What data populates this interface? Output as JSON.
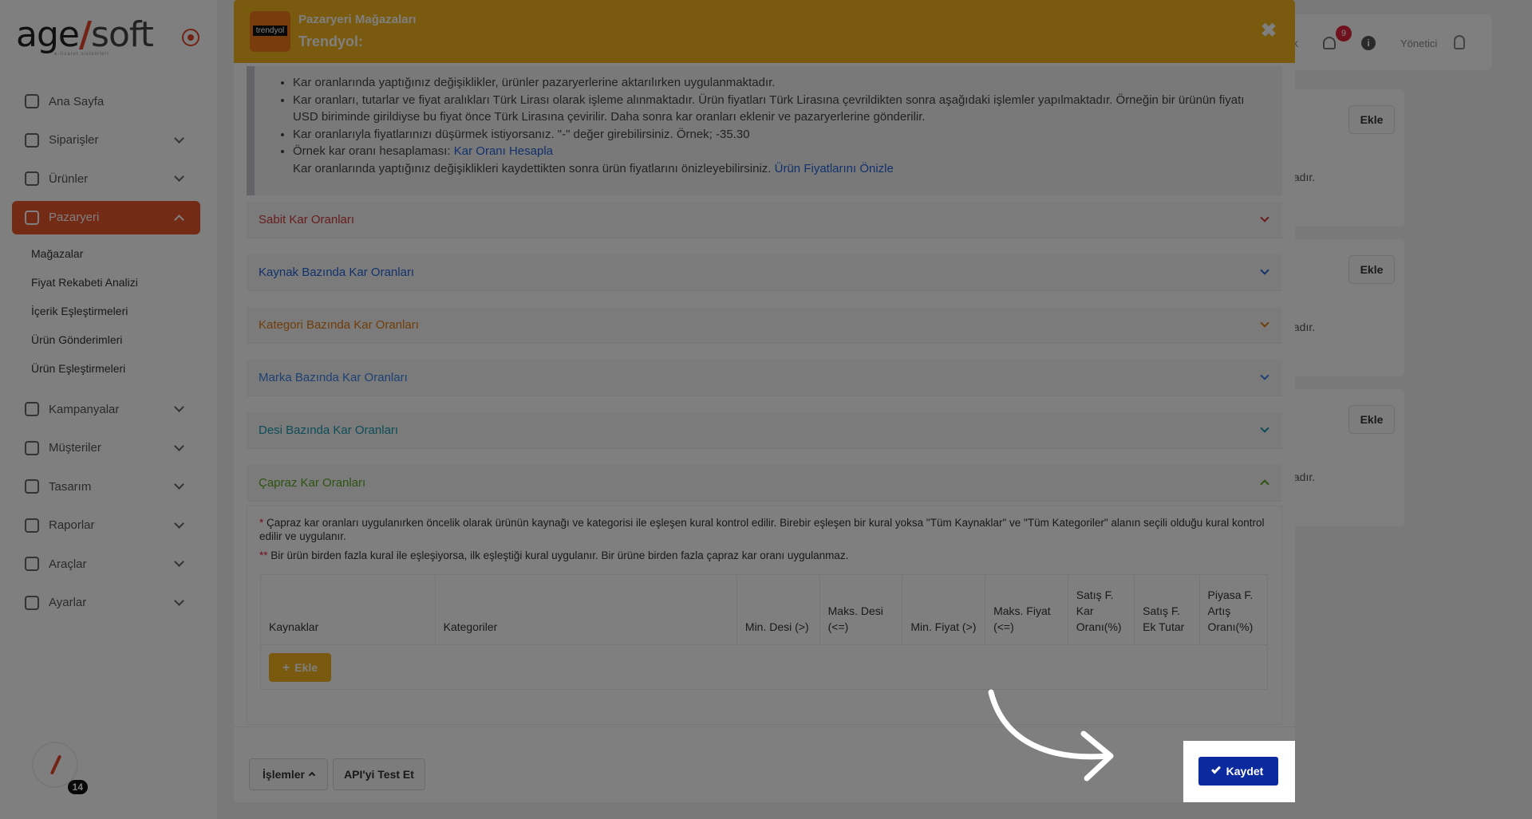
{
  "sidebar": {
    "logo_main": "age",
    "logo_slash": "/",
    "logo_soft": "soft",
    "logo_sub": "e-ticaret sistemleri",
    "items": [
      {
        "label": "Ana Sayfa",
        "icon": "home-icon"
      },
      {
        "label": "Siparişler",
        "icon": "cart-icon"
      },
      {
        "label": "Ürünler",
        "icon": "book-icon"
      },
      {
        "label": "Pazaryeri",
        "icon": "box-icon"
      },
      {
        "label": "Kampanyalar",
        "icon": "basket-icon"
      },
      {
        "label": "Müşteriler",
        "icon": "user-icon"
      },
      {
        "label": "Tasarım",
        "icon": "edit-icon"
      },
      {
        "label": "Raporlar",
        "icon": "chart-icon"
      },
      {
        "label": "Araçlar",
        "icon": "clipboard-icon"
      },
      {
        "label": "Ayarlar",
        "icon": "gear-icon"
      }
    ],
    "sub_items": [
      "Mağazalar",
      "Fiyat Rekabeti Analizi",
      "İçerik Eşleştirmeleri",
      "Ürün Gönderimleri",
      "Ürün Eşleştirmeleri"
    ],
    "badge_count": "14"
  },
  "topbar": {
    "partial_text": "k",
    "notification_count": "9",
    "info_glyph": "i",
    "user_name": "Yönetici"
  },
  "background_cards": [
    {
      "button": "Ekle",
      "tail": "ktadır."
    },
    {
      "button": "Ekle",
      "tail": "ktadır."
    },
    {
      "button": "Ekle",
      "tail": "ktadır."
    }
  ],
  "modal": {
    "brand_logo_text": "trendyol",
    "subtitle": "Pazaryeri Mağazaları",
    "title": "Trendyol:",
    "close_glyph": "✖",
    "info": {
      "line1": "Kar oranlarında yaptığınız değişiklikler, ürünler pazaryerlerine aktarılırken uygulanmaktadır.",
      "line2": "Kar oranları, tutarlar ve fiyat aralıkları Türk Lirası olarak işleme alınmaktadır. Ürün fiyatları Türk Lirasına çevrildikten sonra aşağıdaki işlemler yapılmaktadır. Örneğin bir ürünün fiyatı USD biriminde girildiyse bu fiyat önce Türk Lirasına çevirilir. Daha sonra kar oranları eklenir ve pazaryerlerine gönderilir.",
      "line3": "Kar oranlarıyla fiyatlarınızı düşürmek istiyorsanız. \"-\" değer girebilirsiniz. Örnek; -35.30",
      "line4_prefix": "Örnek kar oranı hesaplaması: ",
      "line4_link": "Kar Oranı Hesapla",
      "line5_prefix": "Kar oranlarında yaptığınız değişiklikleri kaydettikten sonra ürün fiyatlarını önizleyebilirsiniz. ",
      "line5_link": "Ürün Fiyatlarını Önizle"
    },
    "sections": [
      {
        "label": "Sabit Kar Oranları",
        "color": "#d23a3a"
      },
      {
        "label": "Kaynak Bazında Kar Oranları",
        "color": "#2563d6"
      },
      {
        "label": "Kategori Bazında Kar Oranları",
        "color": "#e07b12"
      },
      {
        "label": "Marka Bazında Kar Oranları",
        "color": "#3b82e6"
      },
      {
        "label": "Desi Bazında Kar Oranları",
        "color": "#1a9bb0"
      },
      {
        "label": "Çapraz Kar Oranları",
        "color": "#5aa626"
      }
    ],
    "cross": {
      "note1_star": "*",
      "note1": " Çapraz kar oranları uygulanırken öncelik olarak ürünün kaynağı ve kategorisi ile eşleşen kural kontrol edilir. Birebir eşleşen bir kural yoksa \"Tüm Kaynaklar\" ve \"Tüm Kategoriler\" alanın seçili olduğu kural kontrol edilir ve uygulanır.",
      "note2_star": "**",
      "note2": " Bir ürün birden fazla kural ile eşleşiyorsa, ilk eşleştiği kural uygulanır. Bir ürüne birden fazla çapraz kar oranı uygulanmaz.",
      "columns": [
        "Kaynaklar",
        "Kategoriler",
        "Min. Desi (>)",
        "Maks. Desi (<=)",
        "Min. Fiyat (>)",
        "Maks. Fiyat (<=)",
        "Satış F. Kar Oranı(%)",
        "Satış F. Ek Tutar",
        "Piyasa F. Artış Oranı(%)"
      ],
      "add_label": "Ekle"
    },
    "footer": {
      "actions_label": "İşlemler",
      "test_label": "API'yi Test Et",
      "save_label": "Kaydet"
    }
  },
  "colors": {
    "header_bg": "#f4b51d",
    "active_nav": "#e8562b",
    "save_button": "#0b2a9e",
    "brand_logo_bg": "#f27a1a"
  }
}
